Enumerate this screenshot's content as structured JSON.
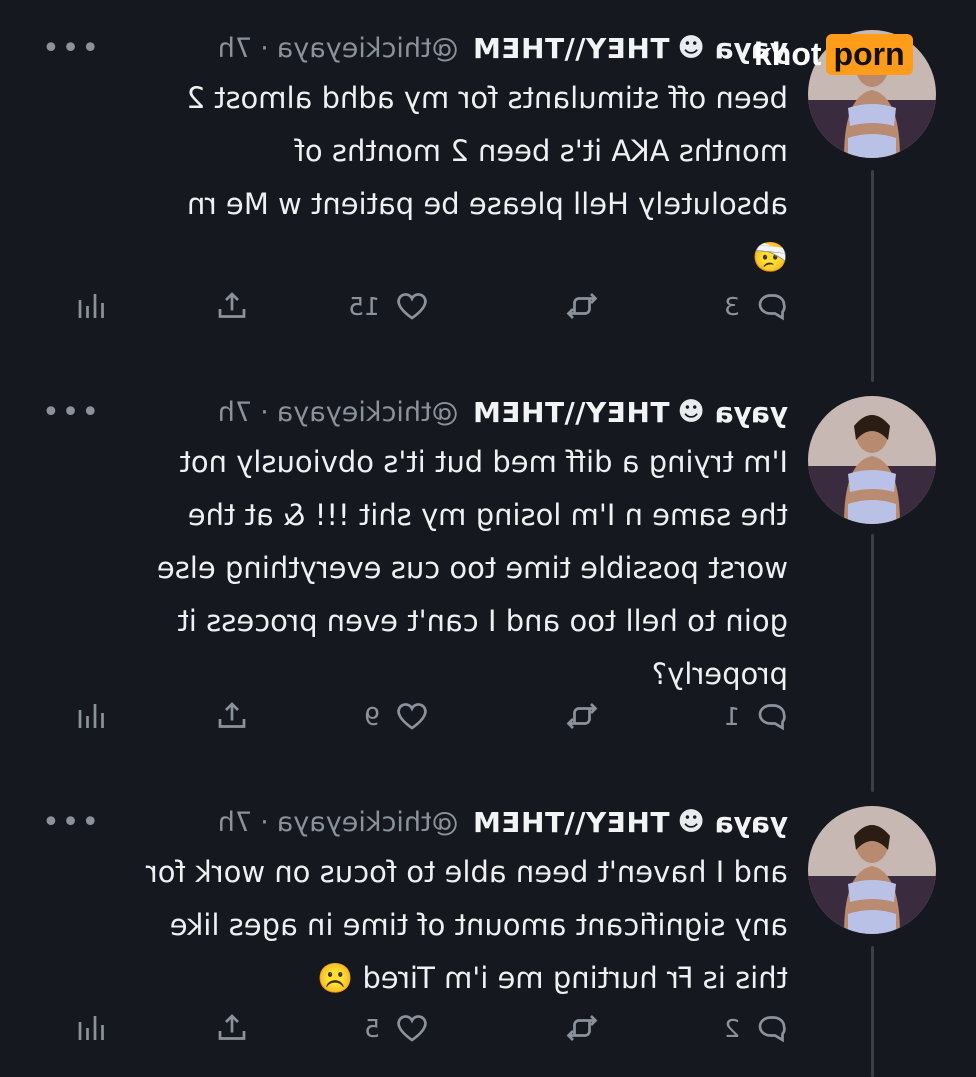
{
  "watermark": {
    "part1": "khot",
    "part2": "porn"
  },
  "tweets": [
    {
      "name": "yaya",
      "emoji": "☻",
      "pronouns": "THEY\\\\THEM",
      "handle": "@thickieyaya",
      "sep": "·",
      "time": "7h",
      "more": "•••",
      "text": "been off stimulants for my adhd almost 2\nmonths AKA it's been 2 months of\nabsolutely Hell please be patient w Me rn\n🤕",
      "replies": "3",
      "likes": "15"
    },
    {
      "name": "yaya",
      "emoji": "☻",
      "pronouns": "THEY\\\\THEM",
      "handle": "@thickieyaya",
      "sep": "·",
      "time": "7h",
      "more": "•••",
      "text": "I'm trying a diff med but it's obviously not\nthe same n I'm losing my shit !!! & at the\nworst possible time too cus everything else\ngoin to hell too and I can't even process it\nproperly?",
      "replies": "1",
      "likes": "9"
    },
    {
      "name": "yaya",
      "emoji": "☻",
      "pronouns": "THEY\\\\THEM",
      "handle": "@thickieyaya",
      "sep": "·",
      "time": "7h",
      "more": "•••",
      "text": "and I haven't been able to focus on work for\nany significant amount of time in ages like\nthis is Fr hurting me i'm Tired ☹️",
      "replies": "2",
      "likes": "5"
    }
  ]
}
